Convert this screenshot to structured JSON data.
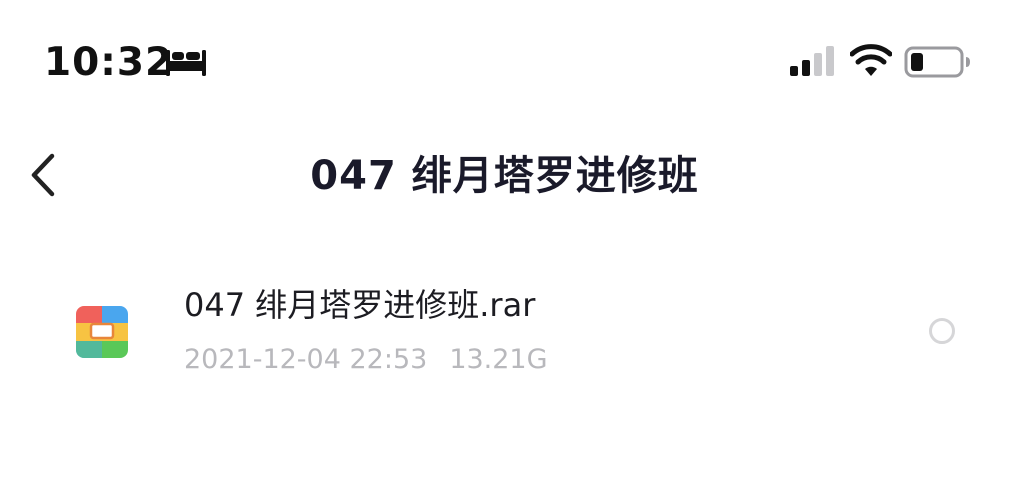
{
  "status_bar": {
    "time": "10:32",
    "focus_icon": "bed-icon",
    "signal_icon": "cellular-signal-icon",
    "wifi_icon": "wifi-icon",
    "battery_icon": "battery-icon",
    "battery_level": 0.2
  },
  "nav": {
    "back_icon": "chevron-left-icon",
    "title": "047 绯月塔罗进修班"
  },
  "files": [
    {
      "icon": "archive-file-icon",
      "name": "047 绯月塔罗进修班.rar",
      "date": "2021-12-04 22:53",
      "size": "13.21G",
      "selected": false
    }
  ],
  "colors": {
    "archive_red": "#f0615b",
    "archive_blue": "#4aa6ee",
    "archive_yellow": "#f7c342",
    "archive_green": "#5ac858",
    "meta_text": "#b8b8bc",
    "radio_border": "#d6d6d8"
  }
}
